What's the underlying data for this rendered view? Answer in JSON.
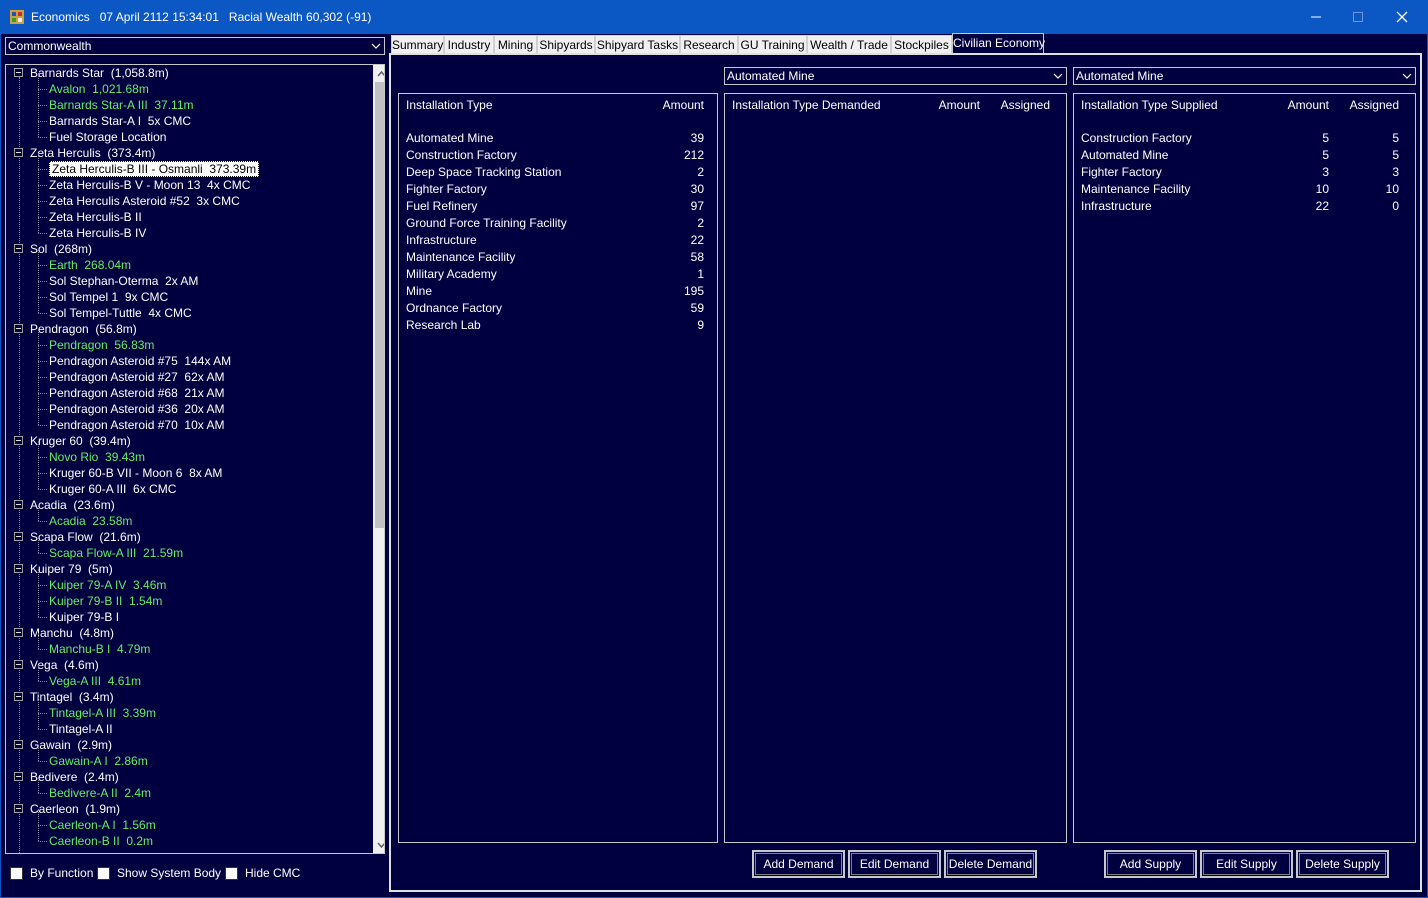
{
  "window": {
    "title": "Economics   07 April 2112 15:34:01   Racial Wealth 60,302 (-91)",
    "colors": {
      "titlebar": "#0b57c4",
      "background": "#000040",
      "green_text": "#66ee66"
    }
  },
  "race_select": {
    "value": "Commonwealth"
  },
  "tree": [
    {
      "label": "Barnards Star  (1,058.8m)",
      "type": "system"
    },
    {
      "label": "Avalon  1,021.68m",
      "type": "pop-green"
    },
    {
      "label": "Barnards Star-A III  37.11m",
      "type": "pop-green"
    },
    {
      "label": "Barnards Star-A I  5x CMC",
      "type": "pop"
    },
    {
      "label": "Fuel Storage Location",
      "type": "pop"
    },
    {
      "label": "Zeta Herculis  (373.4m)",
      "type": "system"
    },
    {
      "label": "Zeta Herculis-B III - Osmanli  373.39m",
      "type": "pop-selected"
    },
    {
      "label": "Zeta Herculis-B V - Moon 13  4x CMC",
      "type": "pop"
    },
    {
      "label": "Zeta Herculis Asteroid #52  3x CMC",
      "type": "pop"
    },
    {
      "label": "Zeta Herculis-B II",
      "type": "pop"
    },
    {
      "label": "Zeta Herculis-B IV",
      "type": "pop"
    },
    {
      "label": "Sol  (268m)",
      "type": "system"
    },
    {
      "label": "Earth  268.04m",
      "type": "pop-green"
    },
    {
      "label": "Sol Stephan-Oterma  2x AM",
      "type": "pop"
    },
    {
      "label": "Sol Tempel 1  9x CMC",
      "type": "pop"
    },
    {
      "label": "Sol Tempel-Tuttle  4x CMC",
      "type": "pop"
    },
    {
      "label": "Pendragon  (56.8m)",
      "type": "system"
    },
    {
      "label": "Pendragon  56.83m",
      "type": "pop-green"
    },
    {
      "label": "Pendragon Asteroid #75  144x AM",
      "type": "pop"
    },
    {
      "label": "Pendragon Asteroid #27  62x AM",
      "type": "pop"
    },
    {
      "label": "Pendragon Asteroid #68  21x AM",
      "type": "pop"
    },
    {
      "label": "Pendragon Asteroid #36  20x AM",
      "type": "pop"
    },
    {
      "label": "Pendragon Asteroid #70  10x AM",
      "type": "pop"
    },
    {
      "label": "Kruger 60  (39.4m)",
      "type": "system"
    },
    {
      "label": "Novo Rio  39.43m",
      "type": "pop-green"
    },
    {
      "label": "Kruger 60-B VII - Moon 6  8x AM",
      "type": "pop"
    },
    {
      "label": "Kruger 60-A III  6x CMC",
      "type": "pop"
    },
    {
      "label": "Acadia  (23.6m)",
      "type": "system"
    },
    {
      "label": "Acadia  23.58m",
      "type": "pop-green"
    },
    {
      "label": "Scapa Flow  (21.6m)",
      "type": "system"
    },
    {
      "label": "Scapa Flow-A III  21.59m",
      "type": "pop-green"
    },
    {
      "label": "Kuiper 79  (5m)",
      "type": "system"
    },
    {
      "label": "Kuiper 79-A IV  3.46m",
      "type": "pop-green"
    },
    {
      "label": "Kuiper 79-B II  1.54m",
      "type": "pop-green"
    },
    {
      "label": "Kuiper 79-B I",
      "type": "pop"
    },
    {
      "label": "Manchu  (4.8m)",
      "type": "system"
    },
    {
      "label": "Manchu-B I  4.79m",
      "type": "pop-green"
    },
    {
      "label": "Vega  (4.6m)",
      "type": "system"
    },
    {
      "label": "Vega-A III  4.61m",
      "type": "pop-green"
    },
    {
      "label": "Tintagel  (3.4m)",
      "type": "system"
    },
    {
      "label": "Tintagel-A III  3.39m",
      "type": "pop-green"
    },
    {
      "label": "Tintagel-A II",
      "type": "pop"
    },
    {
      "label": "Gawain  (2.9m)",
      "type": "system"
    },
    {
      "label": "Gawain-A I  2.86m",
      "type": "pop-green"
    },
    {
      "label": "Bedivere  (2.4m)",
      "type": "system"
    },
    {
      "label": "Bedivere-A II  2.4m",
      "type": "pop-green"
    },
    {
      "label": "Caerleon  (1.9m)",
      "type": "system"
    },
    {
      "label": "Caerleon-A I  1.56m",
      "type": "pop-green"
    },
    {
      "label": "Caerleon-B II  0.2m",
      "type": "pop-green"
    }
  ],
  "options": {
    "by_function": "By Function",
    "show_system_body": "Show System Body",
    "hide_cmc": "Hide CMC"
  },
  "tabs": [
    "Summary",
    "Industry",
    "Mining",
    "Shipyards",
    "Shipyard Tasks",
    "Research",
    "GU Training",
    "Wealth / Trade",
    "Stockpiles",
    "Civilian Economy"
  ],
  "active_tab": "Civilian Economy",
  "demand_select": {
    "value": "Automated Mine"
  },
  "supply_select": {
    "value": "Automated Mine"
  },
  "installations": {
    "headers": {
      "type": "Installation Type",
      "amount": "Amount"
    },
    "rows": [
      {
        "name": "Automated Mine",
        "amount": "39"
      },
      {
        "name": "Construction Factory",
        "amount": "212"
      },
      {
        "name": "Deep Space Tracking Station",
        "amount": "2"
      },
      {
        "name": "Fighter Factory",
        "amount": "30"
      },
      {
        "name": "Fuel Refinery",
        "amount": "97"
      },
      {
        "name": "Ground Force Training Facility",
        "amount": "2"
      },
      {
        "name": "Infrastructure",
        "amount": "22"
      },
      {
        "name": "Maintenance Facility",
        "amount": "58"
      },
      {
        "name": "Military Academy",
        "amount": "1"
      },
      {
        "name": "Mine",
        "amount": "195"
      },
      {
        "name": "Ordnance Factory",
        "amount": "59"
      },
      {
        "name": "Research Lab",
        "amount": "9"
      }
    ]
  },
  "demanded": {
    "headers": {
      "type": "Installation Type Demanded",
      "amount": "Amount",
      "assigned": "Assigned"
    },
    "rows": []
  },
  "supplied": {
    "headers": {
      "type": "Installation Type Supplied",
      "amount": "Amount",
      "assigned": "Assigned"
    },
    "rows": [
      {
        "name": "Construction Factory",
        "amount": "5",
        "assigned": "5"
      },
      {
        "name": "Automated Mine",
        "amount": "5",
        "assigned": "5"
      },
      {
        "name": "Fighter Factory",
        "amount": "3",
        "assigned": "3"
      },
      {
        "name": "Maintenance Facility",
        "amount": "10",
        "assigned": "10"
      },
      {
        "name": "Infrastructure",
        "amount": "22",
        "assigned": "0"
      }
    ]
  },
  "buttons": {
    "add_demand": "Add Demand",
    "edit_demand": "Edit Demand",
    "delete_demand": "Delete Demand",
    "add_supply": "Add Supply",
    "edit_supply": "Edit Supply",
    "delete_supply": "Delete Supply"
  }
}
